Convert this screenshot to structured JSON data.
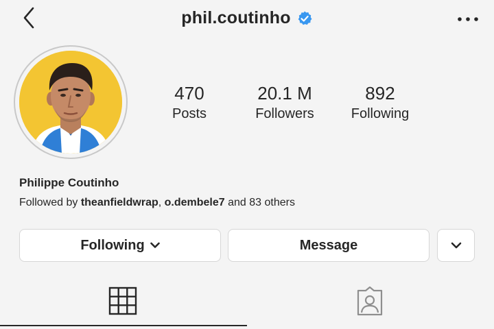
{
  "header": {
    "username": "phil.coutinho",
    "verified": true,
    "back_icon": "chevron-left-icon",
    "more_icon": "more-horizontal-icon"
  },
  "profile": {
    "avatar_description": "profile picture",
    "avatar_bg_color": "#f3c532"
  },
  "stats": [
    {
      "value": "470",
      "label": "Posts"
    },
    {
      "value": "20.1 M",
      "label": "Followers"
    },
    {
      "value": "892",
      "label": "Following"
    }
  ],
  "bio": {
    "full_name": "Philippe Coutinho",
    "followed_by_prefix": "Followed by",
    "followed_by_user1": "theanfieldwrap",
    "followed_by_user2": "o.dembele7",
    "followed_by_suffix": "and 83 others"
  },
  "actions": {
    "following_label": "Following",
    "message_label": "Message",
    "dropdown_icon": "chevron-down-icon"
  },
  "tabs": [
    {
      "name": "grid",
      "icon": "grid-icon",
      "active": true
    },
    {
      "name": "tagged",
      "icon": "tagged-person-icon",
      "active": false
    }
  ],
  "colors": {
    "verified_badge": "#3897f0",
    "text": "#262626",
    "background": "#f4f4f4"
  }
}
